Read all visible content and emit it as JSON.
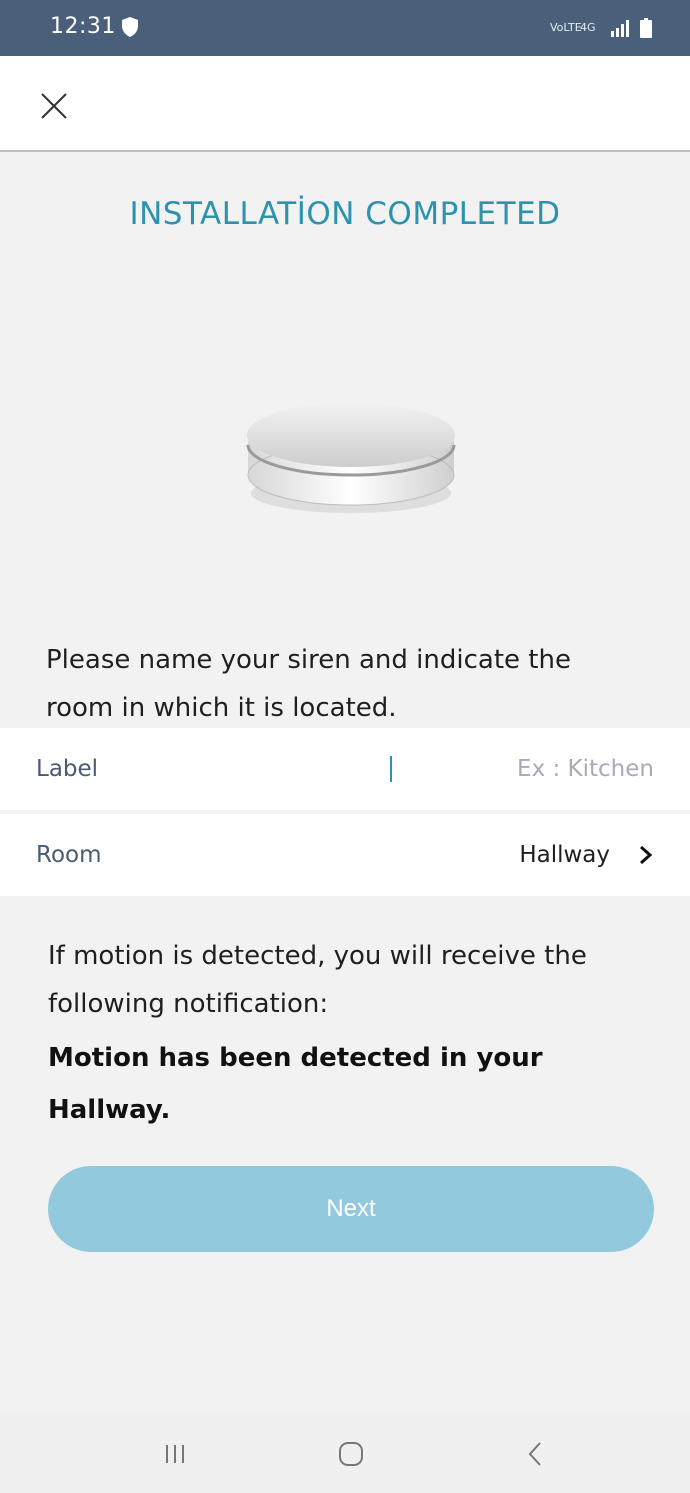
{
  "status_bar": {
    "time": "12:31",
    "volte": "VoLTE",
    "network": "4G"
  },
  "header": {
    "title": "INSTALLATİON COMPLETED"
  },
  "instruction": "Please name your siren and indicate the room in which it is located.",
  "form": {
    "label": {
      "title": "Label",
      "value": "",
      "placeholder": "Ex : Kitchen"
    },
    "room": {
      "title": "Room",
      "value": "Hallway"
    }
  },
  "notification": {
    "intro": "If motion is detected, you will receive the following notification:",
    "message": "Motion has been detected in your Hallway."
  },
  "next_button": {
    "label": "Next"
  },
  "colors": {
    "status_bar": "#4a5f7a",
    "accent": "#2d93ad",
    "button": "#93c9dc"
  },
  "icons": {
    "close": "close-icon",
    "shield": "shield-icon",
    "chevron": "chevron-right-icon",
    "recent": "recent-apps-icon",
    "home": "home-icon",
    "back": "back-icon"
  }
}
